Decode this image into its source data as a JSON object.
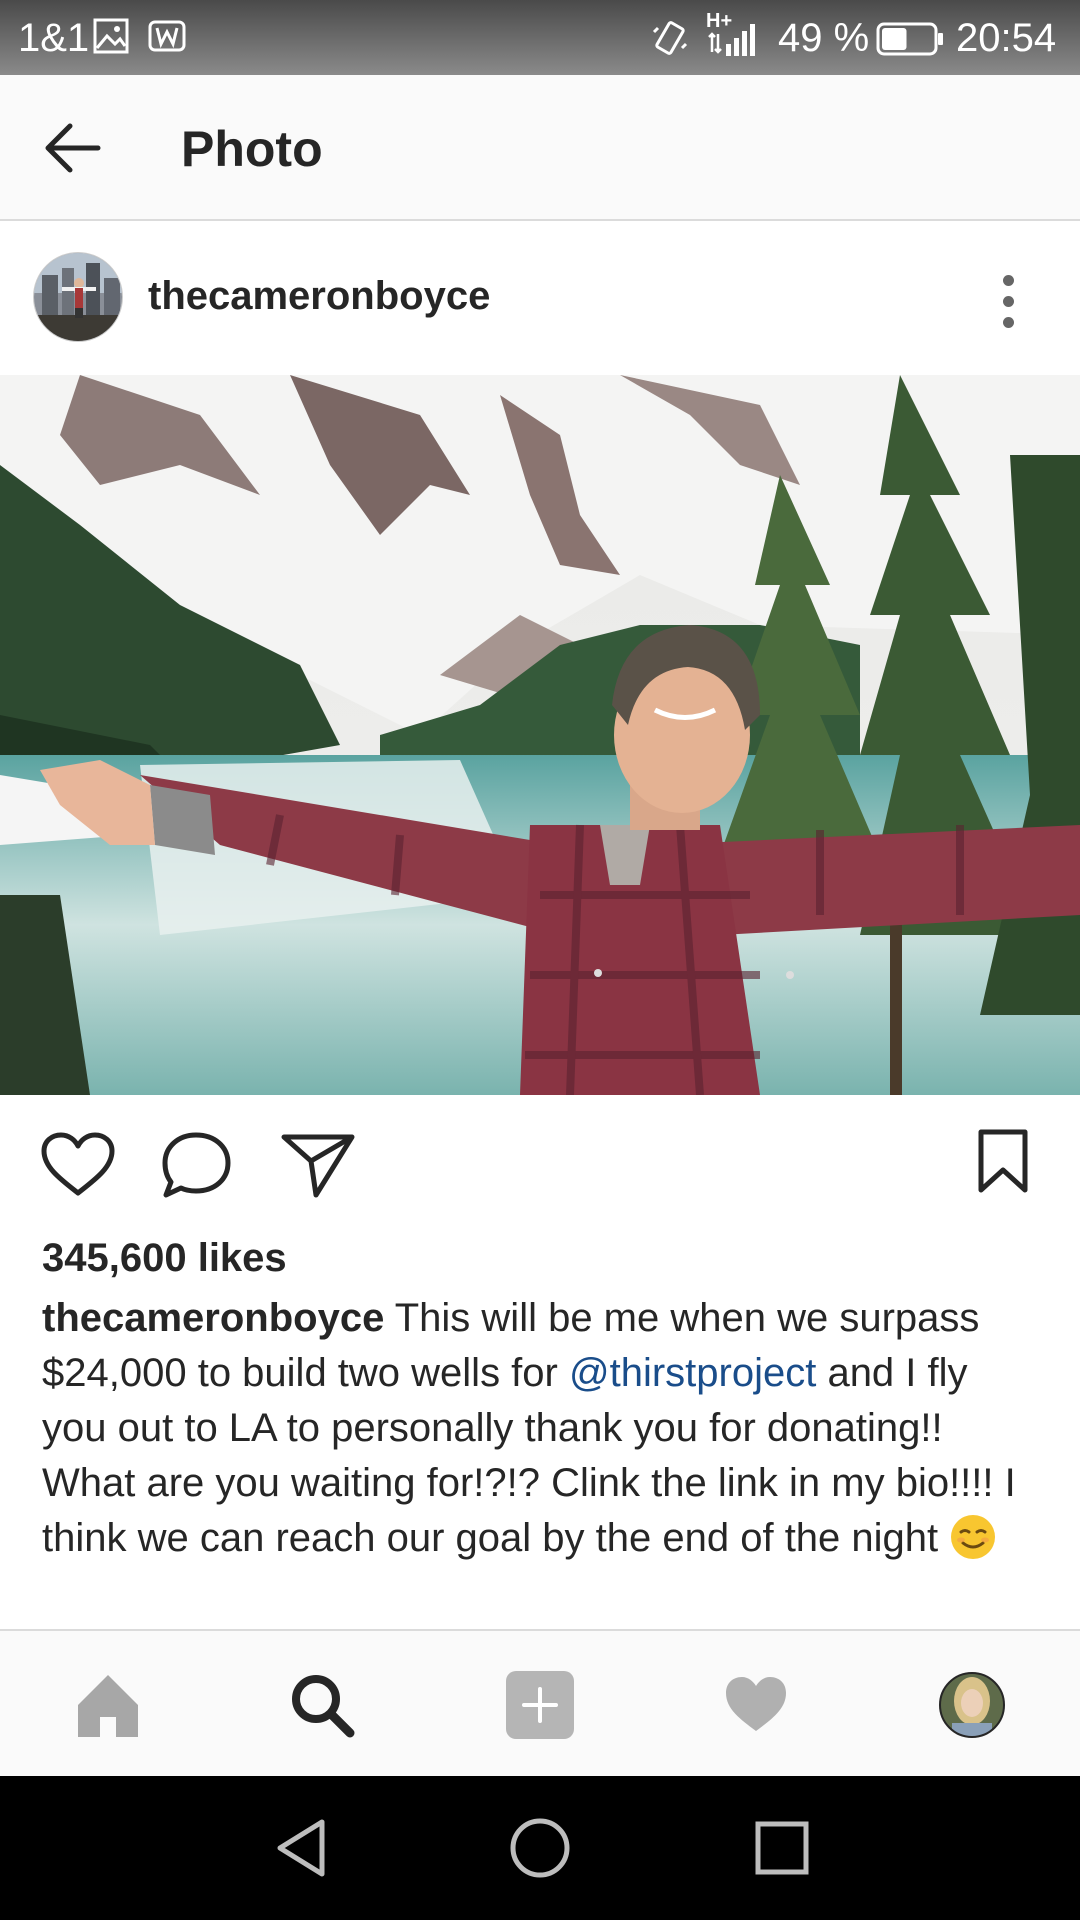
{
  "status_bar": {
    "carrier": "1&1",
    "network_label": "H+",
    "battery_percent": "49 %",
    "battery_level": 0.49,
    "time": "20:54",
    "icons": [
      "image-icon",
      "w-icon",
      "vibrate-icon",
      "signal-icon",
      "battery-icon"
    ]
  },
  "header": {
    "title": "Photo",
    "back_icon": "back-arrow-icon"
  },
  "post": {
    "username": "thecameronboyce",
    "likes": "345,600 likes",
    "caption": {
      "username": "thecameronboyce",
      "text_before": " This will be me when we surpass $24,000 to build two wells for ",
      "mention": "@thirstproject",
      "text_after": " and I fly you out to LA to personally thank you for donating!! What are you waiting for!?!? Clink the link in my bio!!!! I think we can reach our goal by the end of the night ",
      "emoji": "smiling-face-emoji"
    },
    "actions": [
      "heart-icon",
      "comment-icon",
      "share-icon",
      "bookmark-icon"
    ]
  },
  "bottom_nav": {
    "items": [
      "home-icon",
      "search-icon",
      "add-icon",
      "activity-icon",
      "profile-avatar"
    ],
    "active": "search-icon"
  },
  "android_nav": [
    "back-triangle-icon",
    "home-circle-icon",
    "recents-square-icon"
  ],
  "colors": {
    "mention": "#1a4d8a",
    "text": "#262626",
    "divider": "#dbdbdb"
  }
}
